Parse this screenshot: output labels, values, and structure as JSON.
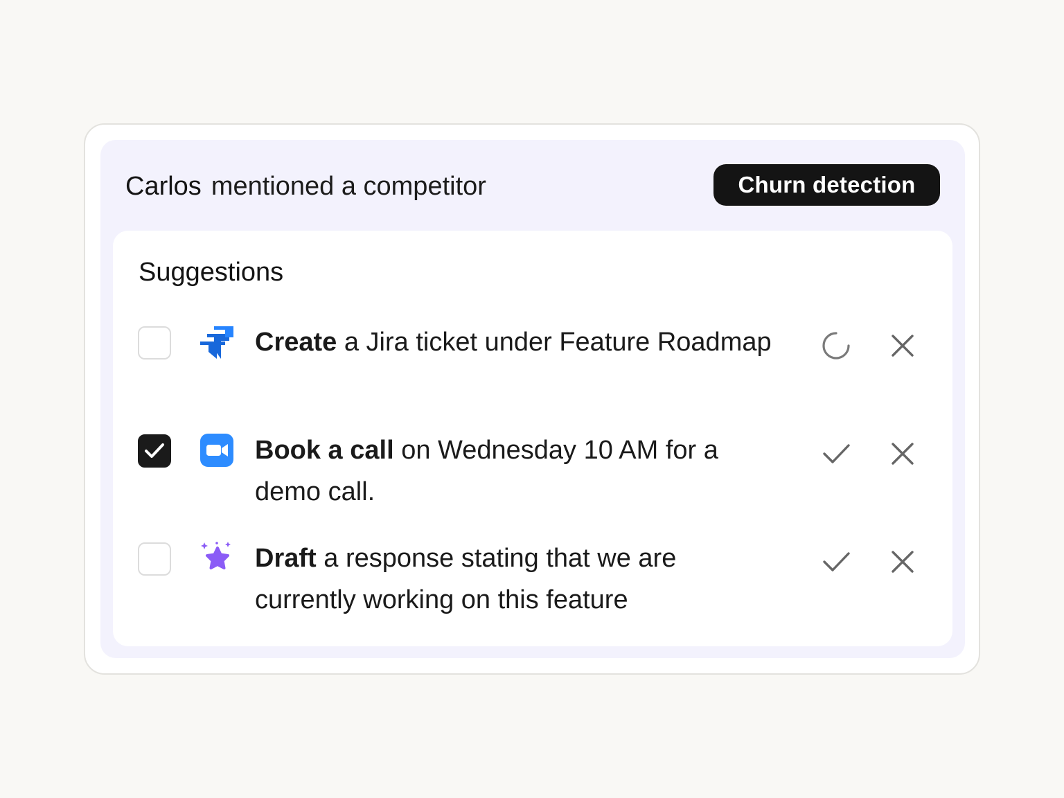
{
  "alert": {
    "actor": "Carlos",
    "message": "mentioned a competitor",
    "tag": "Churn detection"
  },
  "suggestions": {
    "title": "Suggestions",
    "items": [
      {
        "checked": false,
        "app_icon": "jira-icon",
        "verb": "Create",
        "text": "a Jira ticket under Feature Roadmap",
        "primary_action_icon": "loading-spinner-icon",
        "dismiss_icon": "close-icon"
      },
      {
        "checked": true,
        "app_icon": "zoom-video-icon",
        "verb": "Book a call",
        "text": "on Wednesday 10 AM for a demo call.",
        "primary_action_icon": "check-icon",
        "dismiss_icon": "close-icon"
      },
      {
        "checked": false,
        "app_icon": "sparkle-star-icon",
        "verb": "Draft",
        "text": "a response stating that we are currently working on this feature",
        "primary_action_icon": "check-icon",
        "dismiss_icon": "close-icon"
      }
    ]
  },
  "colors": {
    "page_background": "#f9f8f5",
    "header_background": "#f3f2fd",
    "tag_background": "#141414",
    "jira_blue": "#1868db",
    "zoom_blue": "#2d8cff",
    "sparkle_purple": "#8b5cf6"
  }
}
